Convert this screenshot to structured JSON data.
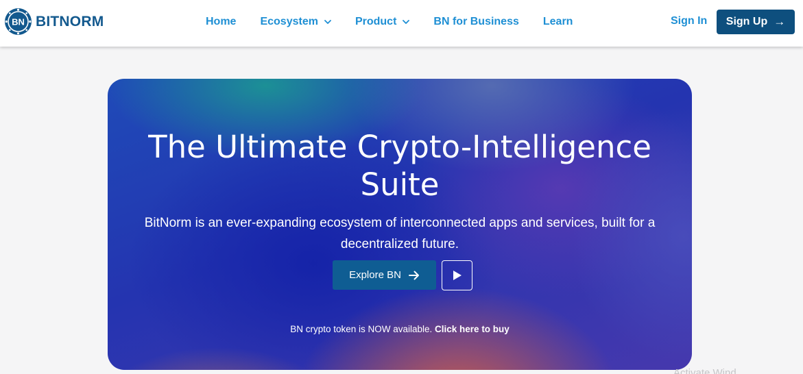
{
  "brand": {
    "name": "BITNORM",
    "logo_text": "BN",
    "logo_icon": "bitnorm-logo-icon",
    "color": "#13598e"
  },
  "nav": {
    "items": [
      {
        "label": "Home",
        "dropdown": false
      },
      {
        "label": "Ecosystem",
        "dropdown": true
      },
      {
        "label": "Product",
        "dropdown": true
      },
      {
        "label": "BN for Business",
        "dropdown": false
      },
      {
        "label": "Learn",
        "dropdown": false
      }
    ],
    "link_color": "#1e8fd4"
  },
  "auth": {
    "signin_label": "Sign In",
    "signup_label": "Sign Up",
    "signup_arrow": "→",
    "signup_color": "#0e4f7e"
  },
  "hero": {
    "title": "The Ultimate Crypto-Intelligence Suite",
    "subtitle": "BitNorm is an ever-expanding ecosystem of interconnected apps and services, built for a decentralized future.",
    "explore_label": "Explore BN",
    "explore_icon": "arrow-right-icon",
    "play_icon": "play-icon",
    "token_text": "BN crypto token is NOW available.",
    "token_link": "Click here to buy"
  },
  "watermark": {
    "text": "Activate Wind"
  }
}
